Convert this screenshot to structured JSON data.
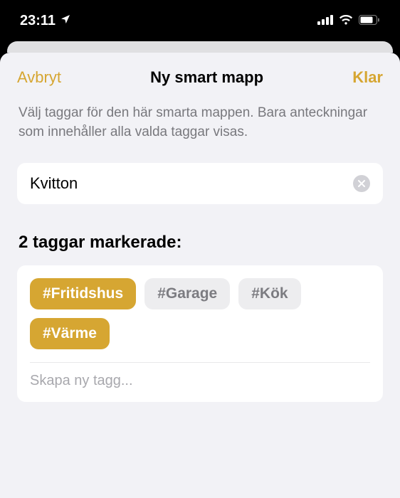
{
  "statusbar": {
    "time": "23:11"
  },
  "header": {
    "cancel_label": "Avbryt",
    "title": "Ny smart mapp",
    "done_label": "Klar"
  },
  "description": "Välj taggar för den här smarta mappen. Bara anteckningar som innehåller alla valda taggar visas.",
  "folder_name": {
    "value": "Kvitton"
  },
  "tags_section": {
    "label": "2 taggar markerade:",
    "tags": [
      {
        "label": "#Fritidshus",
        "selected": true
      },
      {
        "label": "#Garage",
        "selected": false
      },
      {
        "label": "#Kök",
        "selected": false
      },
      {
        "label": "#Värme",
        "selected": true
      }
    ],
    "new_tag_placeholder": "Skapa ny tagg..."
  },
  "colors": {
    "accent": "#d6a632"
  }
}
